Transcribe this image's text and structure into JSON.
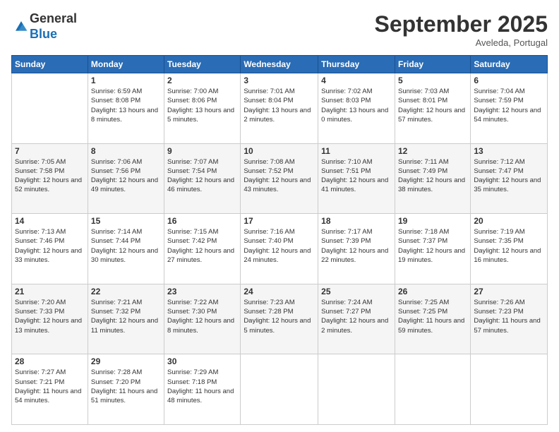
{
  "logo": {
    "line1": "General",
    "line2": "Blue"
  },
  "header": {
    "title": "September 2025",
    "subtitle": "Aveleda, Portugal"
  },
  "weekdays": [
    "Sunday",
    "Monday",
    "Tuesday",
    "Wednesday",
    "Thursday",
    "Friday",
    "Saturday"
  ],
  "weeks": [
    [
      {
        "day": "",
        "sunrise": "",
        "sunset": "",
        "daylight": ""
      },
      {
        "day": "1",
        "sunrise": "Sunrise: 6:59 AM",
        "sunset": "Sunset: 8:08 PM",
        "daylight": "Daylight: 13 hours and 8 minutes."
      },
      {
        "day": "2",
        "sunrise": "Sunrise: 7:00 AM",
        "sunset": "Sunset: 8:06 PM",
        "daylight": "Daylight: 13 hours and 5 minutes."
      },
      {
        "day": "3",
        "sunrise": "Sunrise: 7:01 AM",
        "sunset": "Sunset: 8:04 PM",
        "daylight": "Daylight: 13 hours and 2 minutes."
      },
      {
        "day": "4",
        "sunrise": "Sunrise: 7:02 AM",
        "sunset": "Sunset: 8:03 PM",
        "daylight": "Daylight: 13 hours and 0 minutes."
      },
      {
        "day": "5",
        "sunrise": "Sunrise: 7:03 AM",
        "sunset": "Sunset: 8:01 PM",
        "daylight": "Daylight: 12 hours and 57 minutes."
      },
      {
        "day": "6",
        "sunrise": "Sunrise: 7:04 AM",
        "sunset": "Sunset: 7:59 PM",
        "daylight": "Daylight: 12 hours and 54 minutes."
      }
    ],
    [
      {
        "day": "7",
        "sunrise": "Sunrise: 7:05 AM",
        "sunset": "Sunset: 7:58 PM",
        "daylight": "Daylight: 12 hours and 52 minutes."
      },
      {
        "day": "8",
        "sunrise": "Sunrise: 7:06 AM",
        "sunset": "Sunset: 7:56 PM",
        "daylight": "Daylight: 12 hours and 49 minutes."
      },
      {
        "day": "9",
        "sunrise": "Sunrise: 7:07 AM",
        "sunset": "Sunset: 7:54 PM",
        "daylight": "Daylight: 12 hours and 46 minutes."
      },
      {
        "day": "10",
        "sunrise": "Sunrise: 7:08 AM",
        "sunset": "Sunset: 7:52 PM",
        "daylight": "Daylight: 12 hours and 43 minutes."
      },
      {
        "day": "11",
        "sunrise": "Sunrise: 7:10 AM",
        "sunset": "Sunset: 7:51 PM",
        "daylight": "Daylight: 12 hours and 41 minutes."
      },
      {
        "day": "12",
        "sunrise": "Sunrise: 7:11 AM",
        "sunset": "Sunset: 7:49 PM",
        "daylight": "Daylight: 12 hours and 38 minutes."
      },
      {
        "day": "13",
        "sunrise": "Sunrise: 7:12 AM",
        "sunset": "Sunset: 7:47 PM",
        "daylight": "Daylight: 12 hours and 35 minutes."
      }
    ],
    [
      {
        "day": "14",
        "sunrise": "Sunrise: 7:13 AM",
        "sunset": "Sunset: 7:46 PM",
        "daylight": "Daylight: 12 hours and 33 minutes."
      },
      {
        "day": "15",
        "sunrise": "Sunrise: 7:14 AM",
        "sunset": "Sunset: 7:44 PM",
        "daylight": "Daylight: 12 hours and 30 minutes."
      },
      {
        "day": "16",
        "sunrise": "Sunrise: 7:15 AM",
        "sunset": "Sunset: 7:42 PM",
        "daylight": "Daylight: 12 hours and 27 minutes."
      },
      {
        "day": "17",
        "sunrise": "Sunrise: 7:16 AM",
        "sunset": "Sunset: 7:40 PM",
        "daylight": "Daylight: 12 hours and 24 minutes."
      },
      {
        "day": "18",
        "sunrise": "Sunrise: 7:17 AM",
        "sunset": "Sunset: 7:39 PM",
        "daylight": "Daylight: 12 hours and 22 minutes."
      },
      {
        "day": "19",
        "sunrise": "Sunrise: 7:18 AM",
        "sunset": "Sunset: 7:37 PM",
        "daylight": "Daylight: 12 hours and 19 minutes."
      },
      {
        "day": "20",
        "sunrise": "Sunrise: 7:19 AM",
        "sunset": "Sunset: 7:35 PM",
        "daylight": "Daylight: 12 hours and 16 minutes."
      }
    ],
    [
      {
        "day": "21",
        "sunrise": "Sunrise: 7:20 AM",
        "sunset": "Sunset: 7:33 PM",
        "daylight": "Daylight: 12 hours and 13 minutes."
      },
      {
        "day": "22",
        "sunrise": "Sunrise: 7:21 AM",
        "sunset": "Sunset: 7:32 PM",
        "daylight": "Daylight: 12 hours and 11 minutes."
      },
      {
        "day": "23",
        "sunrise": "Sunrise: 7:22 AM",
        "sunset": "Sunset: 7:30 PM",
        "daylight": "Daylight: 12 hours and 8 minutes."
      },
      {
        "day": "24",
        "sunrise": "Sunrise: 7:23 AM",
        "sunset": "Sunset: 7:28 PM",
        "daylight": "Daylight: 12 hours and 5 minutes."
      },
      {
        "day": "25",
        "sunrise": "Sunrise: 7:24 AM",
        "sunset": "Sunset: 7:27 PM",
        "daylight": "Daylight: 12 hours and 2 minutes."
      },
      {
        "day": "26",
        "sunrise": "Sunrise: 7:25 AM",
        "sunset": "Sunset: 7:25 PM",
        "daylight": "Daylight: 11 hours and 59 minutes."
      },
      {
        "day": "27",
        "sunrise": "Sunrise: 7:26 AM",
        "sunset": "Sunset: 7:23 PM",
        "daylight": "Daylight: 11 hours and 57 minutes."
      }
    ],
    [
      {
        "day": "28",
        "sunrise": "Sunrise: 7:27 AM",
        "sunset": "Sunset: 7:21 PM",
        "daylight": "Daylight: 11 hours and 54 minutes."
      },
      {
        "day": "29",
        "sunrise": "Sunrise: 7:28 AM",
        "sunset": "Sunset: 7:20 PM",
        "daylight": "Daylight: 11 hours and 51 minutes."
      },
      {
        "day": "30",
        "sunrise": "Sunrise: 7:29 AM",
        "sunset": "Sunset: 7:18 PM",
        "daylight": "Daylight: 11 hours and 48 minutes."
      },
      {
        "day": "",
        "sunrise": "",
        "sunset": "",
        "daylight": ""
      },
      {
        "day": "",
        "sunrise": "",
        "sunset": "",
        "daylight": ""
      },
      {
        "day": "",
        "sunrise": "",
        "sunset": "",
        "daylight": ""
      },
      {
        "day": "",
        "sunrise": "",
        "sunset": "",
        "daylight": ""
      }
    ]
  ]
}
